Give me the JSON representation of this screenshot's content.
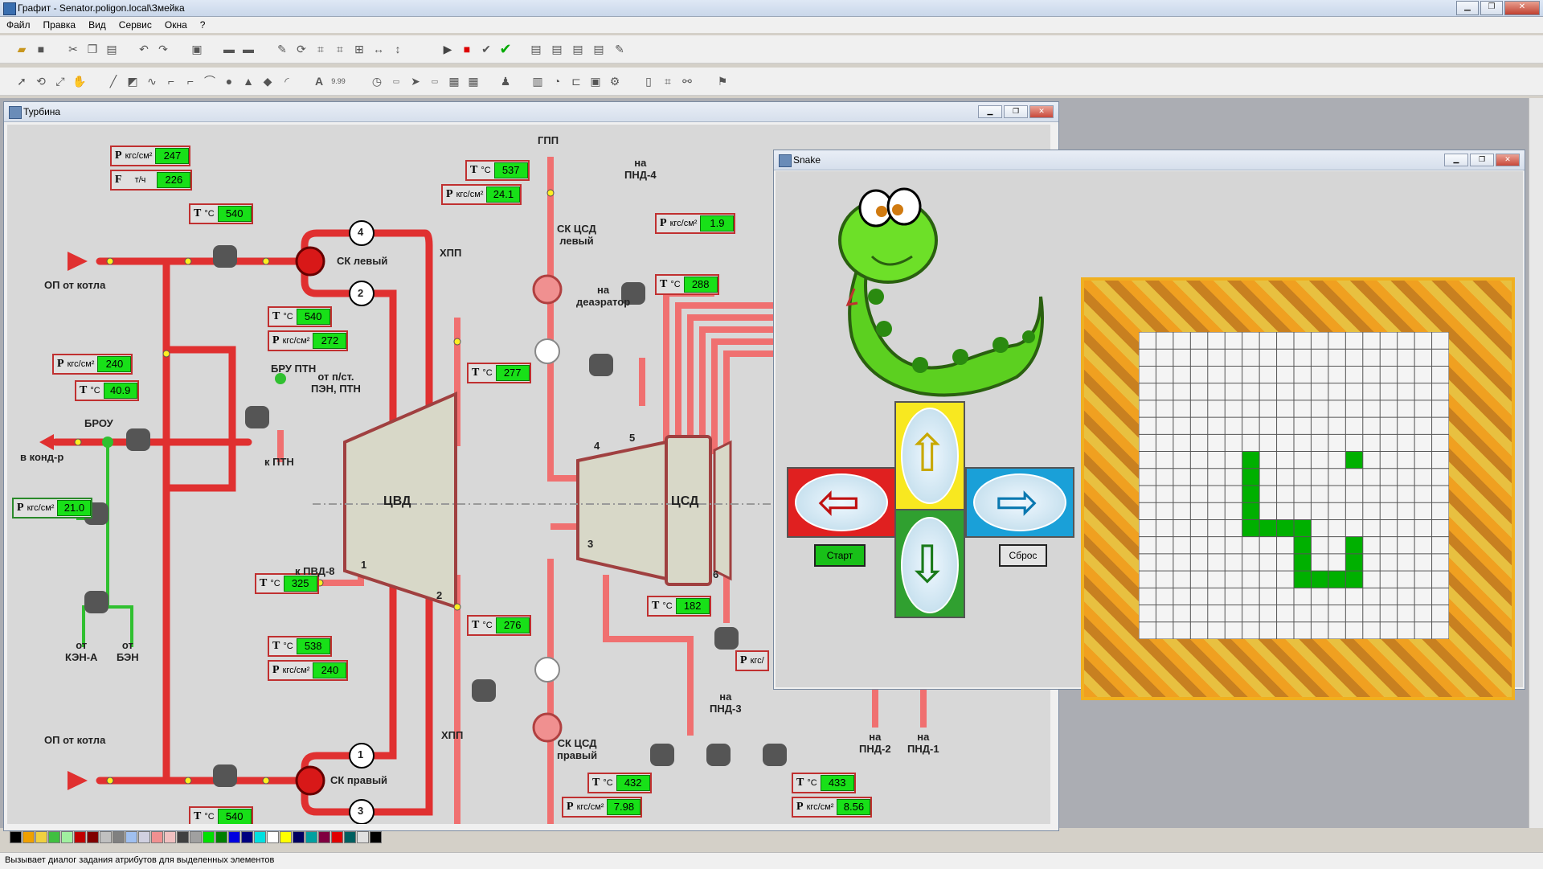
{
  "app": {
    "title": "Графит - Senator.poligon.local\\Змейка"
  },
  "menu": [
    "Файл",
    "Правка",
    "Вид",
    "Сервис",
    "Окна",
    "?"
  ],
  "turbine_window": {
    "title": "Турбина",
    "readouts": [
      {
        "label": "P",
        "unit": "кгс/см²",
        "value": "247"
      },
      {
        "label": "F",
        "unit": "т/ч",
        "value": "226"
      },
      {
        "label": "T",
        "unit": "°C",
        "value": "540"
      },
      {
        "label": "T",
        "unit": "°C",
        "value": "540"
      },
      {
        "label": "P",
        "unit": "кгс/см²",
        "value": "272"
      },
      {
        "label": "P",
        "unit": "кгс/см²",
        "value": "240"
      },
      {
        "label": "T",
        "unit": "°C",
        "value": "40.9"
      },
      {
        "label": "P",
        "unit": "кгс/см²",
        "value": "21.0"
      },
      {
        "label": "T",
        "unit": "°C",
        "value": "325"
      },
      {
        "label": "T",
        "unit": "°C",
        "value": "538"
      },
      {
        "label": "P",
        "unit": "кгс/см²",
        "value": "240"
      },
      {
        "label": "T",
        "unit": "°C",
        "value": "540"
      },
      {
        "label": "T",
        "unit": "°C",
        "value": "537"
      },
      {
        "label": "P",
        "unit": "кгс/см²",
        "value": "24.1"
      },
      {
        "label": "T",
        "unit": "°C",
        "value": "277"
      },
      {
        "label": "T",
        "unit": "°C",
        "value": "276"
      },
      {
        "label": "P",
        "unit": "кгс/см²",
        "value": "1.9"
      },
      {
        "label": "T",
        "unit": "°C",
        "value": "288"
      },
      {
        "label": "T",
        "unit": "°C",
        "value": "182"
      },
      {
        "label": "T",
        "unit": "°C",
        "value": "432"
      },
      {
        "label": "P",
        "unit": "кгс/см²",
        "value": "7.98"
      },
      {
        "label": "T",
        "unit": "°C",
        "value": "433"
      },
      {
        "label": "P",
        "unit": "кгс/см²",
        "value": "8.56"
      },
      {
        "label": "P",
        "unit": "кгс/",
        "value": ""
      }
    ],
    "labels": {
      "op_top": "ОП от котла",
      "op_bottom": "ОП от котла",
      "ck_left": "СК левый",
      "ck_right": "СК правый",
      "bru": "БРУ ПТН",
      "from_pst": "от п/ст.\nПЭН, ПТН",
      "to_ptn": "к ПТН",
      "brou": "БРОУ",
      "to_cond": "в конд-р",
      "from_ken": "от\nКЭН-А",
      "from_ben": "от\nБЭН",
      "to_pvd8": "к ПВД-8",
      "cvd": "ЦВД",
      "csd": "ЦСД",
      "hpp_top": "ХПП",
      "hpp_bottom": "ХПП",
      "gpp": "ГПП",
      "ck_csd_left": "СК ЦСД\nлевый",
      "ck_csd_right": "СК ЦСД\nправый",
      "to_pnd4": "на\nПНД-4",
      "to_deaerator": "на\nдеаэратор",
      "to_pnd3": "на\nПНД-3",
      "to_pnd2": "на\nПНД-2",
      "to_pnd1": "на\nПНД-1",
      "n1": "1",
      "n2": "2",
      "n3": "3",
      "n4": "4",
      "n5": "5",
      "n6": "6"
    }
  },
  "snake_window": {
    "title": "Snake",
    "start_label": "Старт",
    "reset_label": "Сброс",
    "grid": {
      "cols": 18,
      "rows": 18
    }
  },
  "status": {
    "text": "Вызывает диалог задания атрибутов для выделенных элементов"
  },
  "colors": {
    "pipe": "#e03030",
    "readout_green": "#18e018",
    "snake": "#00b000"
  }
}
